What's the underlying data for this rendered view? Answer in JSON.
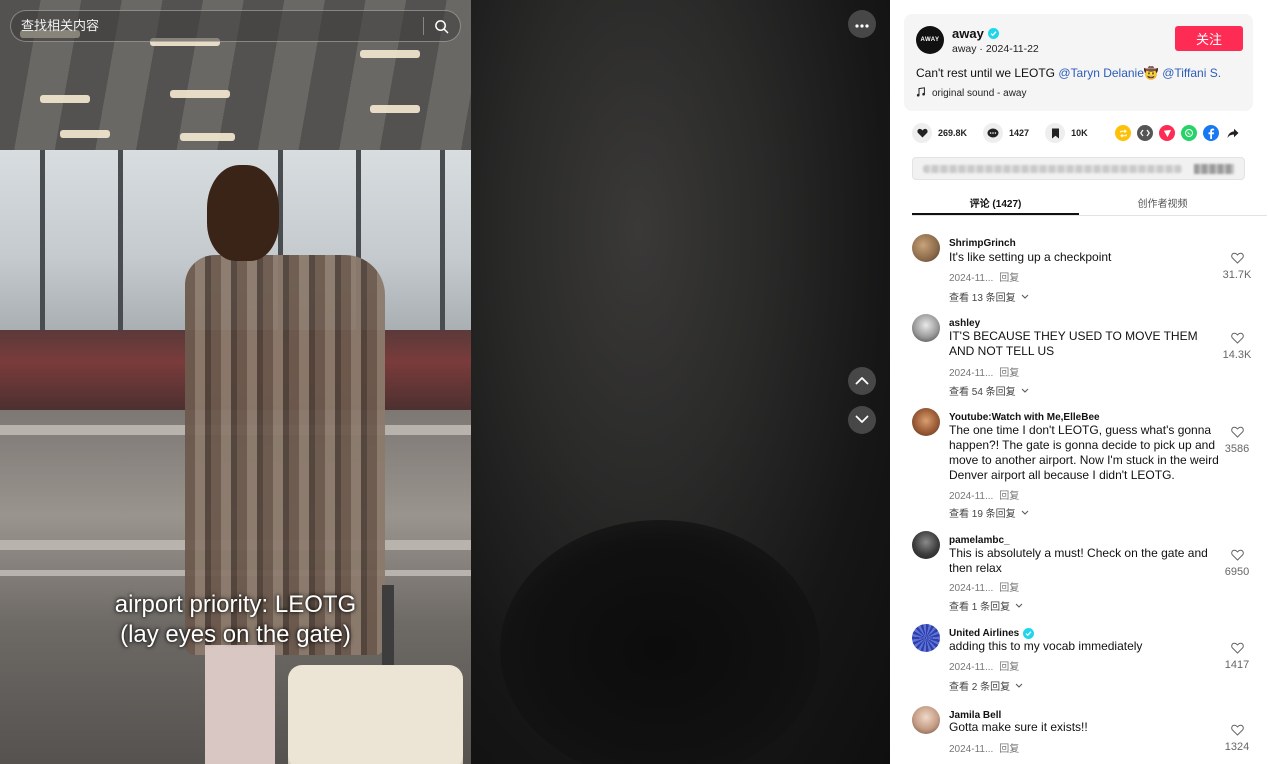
{
  "search": {
    "placeholder": "查找相关内容"
  },
  "video": {
    "caption_line1": "airport priority: LEOTG",
    "caption_line2": "(lay eyes on the gate)"
  },
  "author": {
    "avatar_text": "AWAY",
    "name": "away",
    "sub": "away · 2024-11-22",
    "follow_label": "关注",
    "desc_text": "Can't rest until we LEOTG ",
    "mention1": "@Taryn Delanie🤠",
    "mention2": "@Tiffani S.",
    "music": "original sound - away"
  },
  "stats": {
    "likes": "269.8K",
    "comments": "1427",
    "saves": "10K"
  },
  "tabs": [
    {
      "label": "评论 (1427)"
    },
    {
      "label": "创作者视频"
    }
  ],
  "comments": [
    {
      "user": "ShrimpGrinch",
      "text": "It's like setting up a checkpoint",
      "date": "2024-11...",
      "reply": "回复",
      "view": "查看 13 条回复",
      "likes": "31.7K"
    },
    {
      "user": "ashley",
      "text": "IT'S BECAUSE THEY USED TO MOVE THEM AND NOT TELL US",
      "date": "2024-11...",
      "reply": "回复",
      "view": "查看 54 条回复",
      "likes": "14.3K"
    },
    {
      "user": "Youtube:Watch with Me,ElleBee",
      "text": "The one time I don't LEOTG, guess what's gonna happen?! The gate is gonna decide to pick up and move to another airport. Now I'm stuck in the weird Denver airport all because I didn't LEOTG.",
      "date": "2024-11...",
      "reply": "回复",
      "view": "查看 19 条回复",
      "likes": "3586"
    },
    {
      "user": "pamelambc_",
      "text": "This is absolutely a must! Check on the gate and then relax",
      "date": "2024-11...",
      "reply": "回复",
      "view": "查看 1 条回复",
      "likes": "6950"
    },
    {
      "user": "United Airlines",
      "text": "adding this to my vocab immediately",
      "date": "2024-11...",
      "reply": "回复",
      "view": "查看 2 条回复",
      "likes": "1417"
    },
    {
      "user": "Jamila Bell",
      "text": "Gotta make sure it exists!!",
      "date": "2024-11...",
      "reply": "回复",
      "view": "",
      "likes": "1324"
    }
  ],
  "colors": {
    "follow": "#fe2c55",
    "mention": "#2b5db9",
    "verified": "#20d5ec"
  },
  "icons": [
    "search-icon",
    "more-icon",
    "chevron-up-icon",
    "chevron-down-icon",
    "music-note-icon",
    "heart-icon",
    "comment-icon",
    "bookmark-icon",
    "repost-icon",
    "embed-icon",
    "send-icon",
    "whatsapp-icon",
    "facebook-icon",
    "share-arrow-icon"
  ]
}
